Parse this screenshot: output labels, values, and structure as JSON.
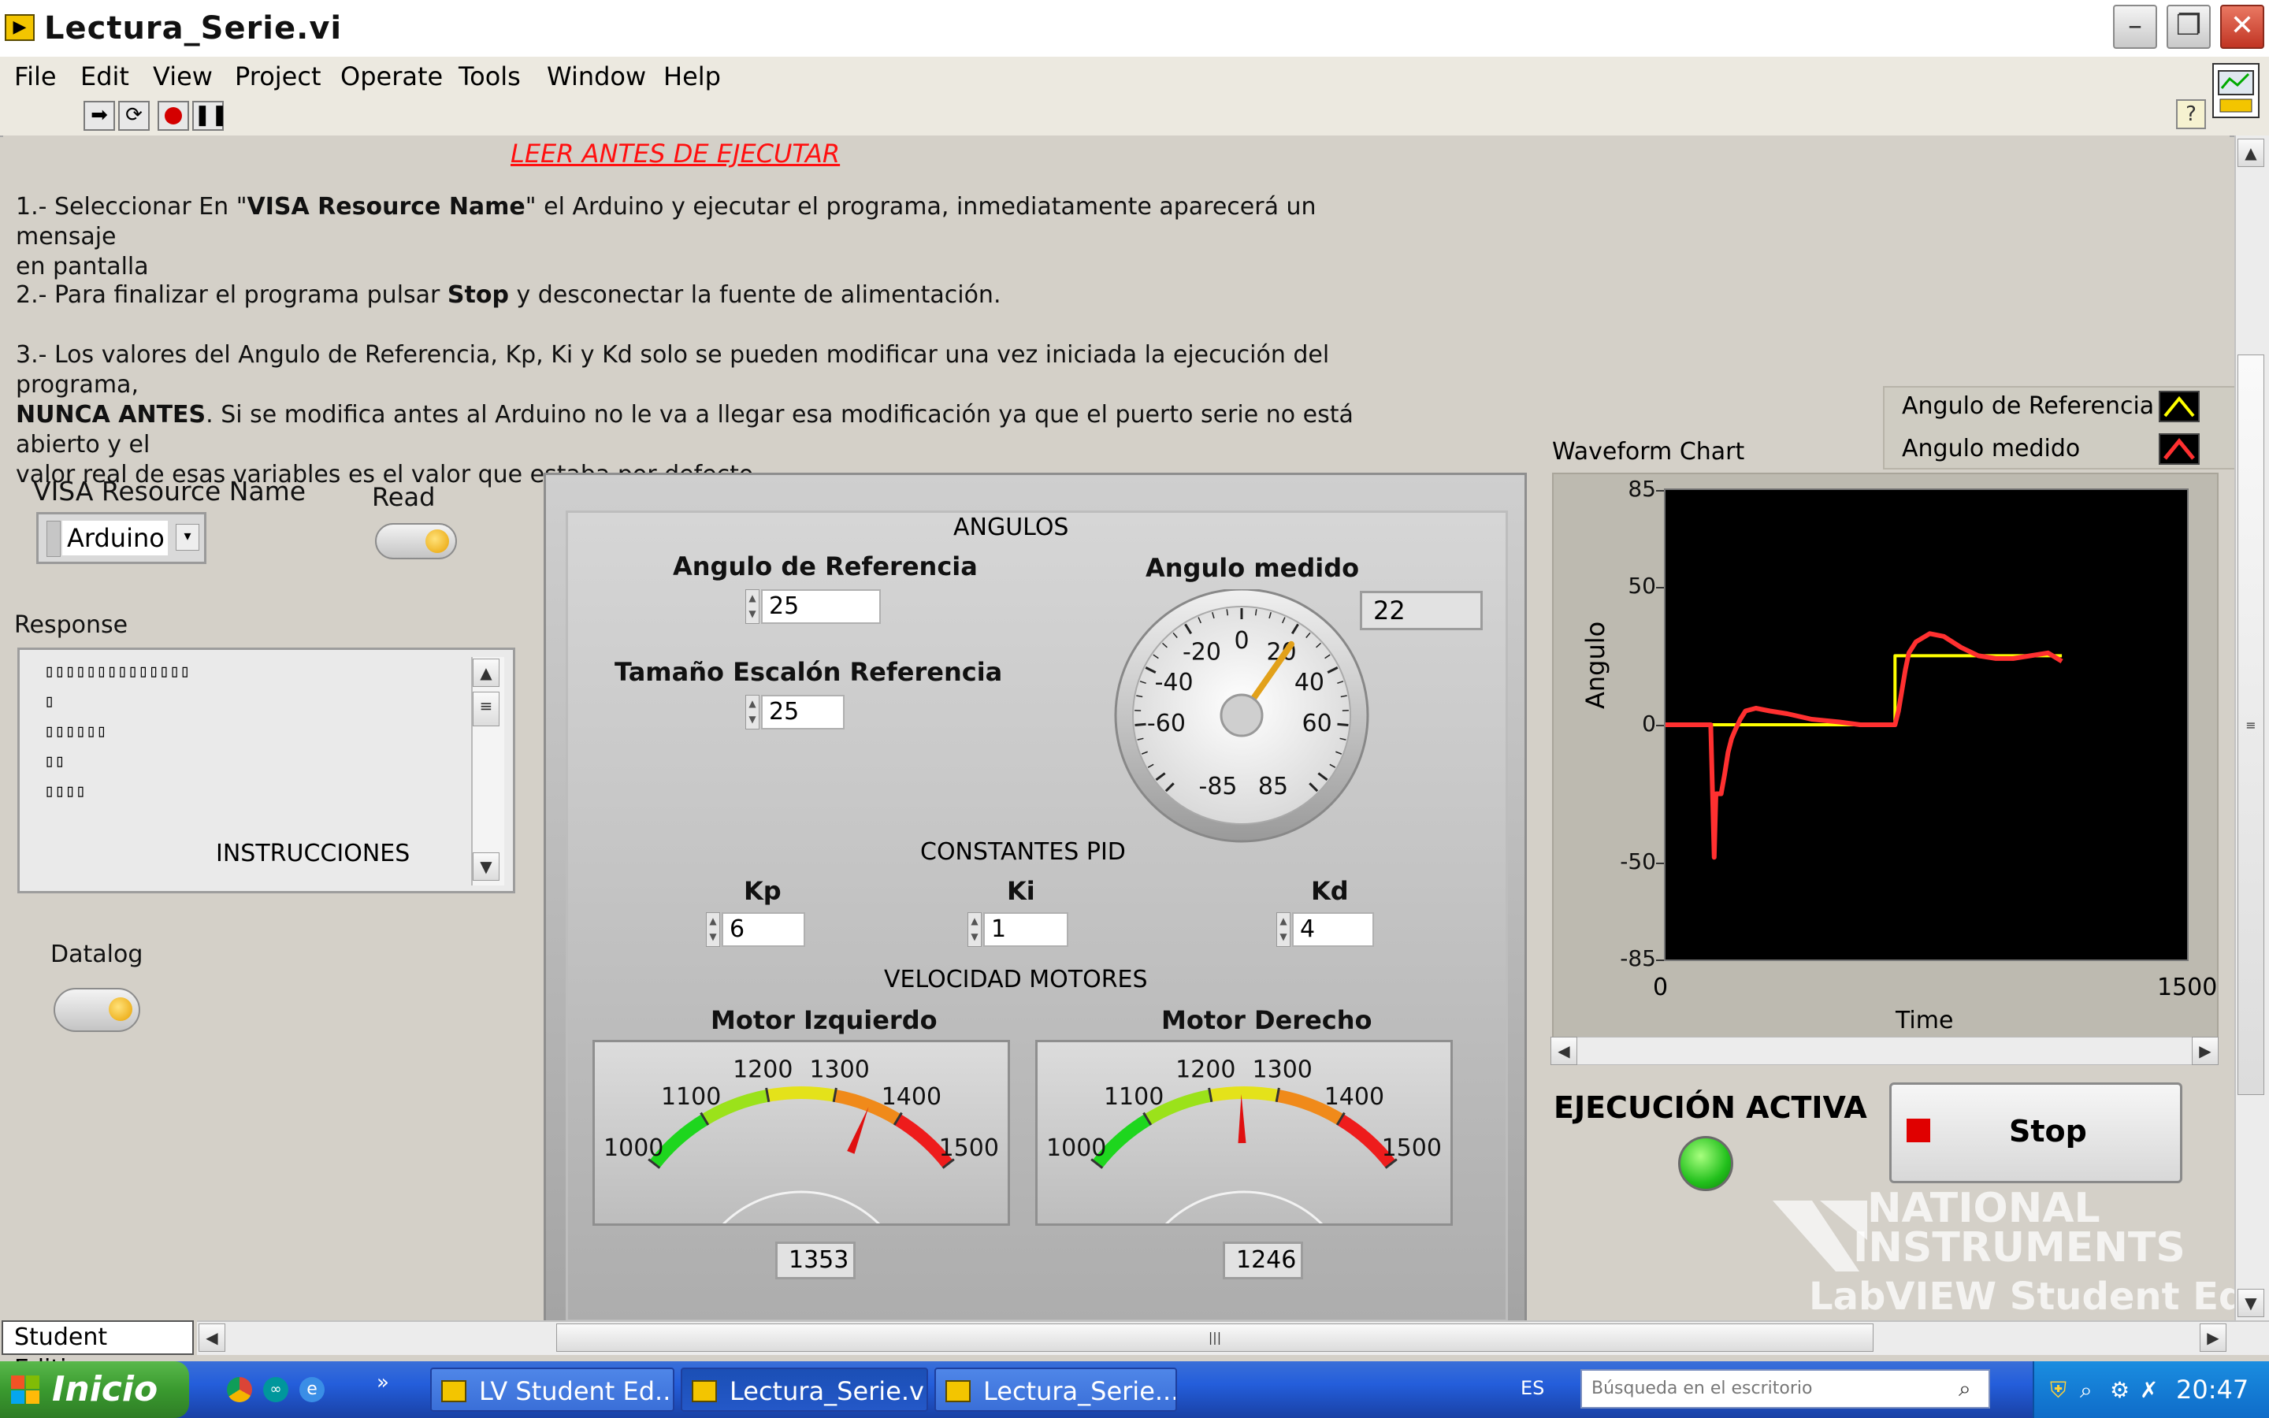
{
  "window": {
    "title": "Lectura_Serie.vi"
  },
  "menu": [
    "File",
    "Edit",
    "View",
    "Project",
    "Operate",
    "Tools",
    "Window",
    "Help"
  ],
  "toolbar": {
    "run_icon": "run-arrow-icon",
    "run_cont_icon": "run-continuously-icon",
    "abort_icon": "abort-icon",
    "pause_icon": "pause-icon",
    "help_label": "?"
  },
  "instructions": {
    "warning": "LEER ANTES DE EJECUTAR",
    "p1_a": "1.- Seleccionar En \"",
    "p1_b": "VISA Resource Name",
    "p1_c": "\" el Arduino y ejecutar el programa, inmediatamente aparecerá un mensaje",
    "p1_d": "en pantalla",
    "p2_a": "2.- Para finalizar el programa pulsar ",
    "p2_b": "Stop",
    "p2_c": " y desconectar la fuente de alimentación.",
    "p3_a": "3.- Los valores del Angulo de Referencia, Kp, Ki y Kd solo se pueden modificar una vez iniciada la ejecución del programa,",
    "p3_b": "NUNCA ANTES",
    "p3_c": ". Si se modifica antes al Arduino no le va a llegar esa modificación ya que el puerto serie no está abierto y el",
    "p3_d": "valor real de esas variables es el valor que estaba por defecto."
  },
  "visa": {
    "label": "VISA Resource Name",
    "value": "Arduino"
  },
  "read": {
    "label": "Read"
  },
  "response": {
    "label": "Response",
    "lines": [
      "▯▯▯▯▯▯▯▯▯▯▯▯▯▯",
      "▯",
      "▯▯▯▯▯▯",
      "▯▯",
      "▯▯▯▯"
    ],
    "footer": "INSTRUCCIONES"
  },
  "datalog": {
    "label": "Datalog"
  },
  "angulos": {
    "title": "ANGULOS",
    "ref_label": "Angulo de Referencia",
    "ref_value": "25",
    "step_label": "Tamaño Escalón Referencia",
    "step_value": "25",
    "measured_label": "Angulo medido",
    "measured_value": "22",
    "dial_ticks": [
      "0",
      "20",
      "40",
      "60",
      "85",
      "-85",
      "-60",
      "-40",
      "-20"
    ],
    "dial_value": 22
  },
  "pid": {
    "title": "CONSTANTES PID",
    "kp_label": "Kp",
    "kp_value": "6",
    "ki_label": "Ki",
    "ki_value": "1",
    "kd_label": "Kd",
    "kd_value": "4"
  },
  "motores": {
    "title": "VELOCIDAD MOTORES",
    "left_label": "Motor Izquierdo",
    "left_value": "1353",
    "left_level": 1353,
    "right_label": "Motor Derecho",
    "right_value": "1246",
    "right_level": 1246,
    "ticks": [
      "1000",
      "1100",
      "1200",
      "1300",
      "1400",
      "1500"
    ]
  },
  "chart": {
    "title": "Waveform Chart",
    "ylabel": "Angulo",
    "xlabel": "Time",
    "yticks": [
      "85",
      "50",
      "0",
      "-50",
      "-85"
    ],
    "xticks": [
      "0",
      "1500"
    ],
    "legend": [
      {
        "name": "Angulo de Referencia",
        "color": "#ffff00"
      },
      {
        "name": "Angulo medido",
        "color": "#ff3030"
      }
    ]
  },
  "chart_data": {
    "type": "line",
    "xlabel": "Time",
    "ylabel": "Angulo",
    "xlim": [
      0,
      1500
    ],
    "ylim": [
      -85,
      85
    ],
    "grid": false,
    "legend_position": "top-right",
    "series": [
      {
        "name": "Angulo de Referencia",
        "color": "#ffff00",
        "x": [
          0,
          110,
          110,
          660,
          660,
          1140
        ],
        "y": [
          0,
          0,
          0,
          0,
          25,
          25
        ]
      },
      {
        "name": "Angulo medido",
        "color": "#ff3030",
        "x": [
          0,
          130,
          140,
          145,
          160,
          170,
          180,
          190,
          200,
          215,
          230,
          260,
          300,
          350,
          420,
          500,
          560,
          620,
          660,
          670,
          690,
          700,
          720,
          760,
          800,
          850,
          900,
          950,
          1000,
          1050,
          1100,
          1140
        ],
        "y": [
          0,
          0,
          -48,
          -25,
          -25,
          -18,
          -10,
          -5,
          -2,
          2,
          5,
          6,
          5,
          4,
          2,
          1,
          0,
          0,
          0,
          5,
          20,
          26,
          30,
          33,
          32,
          28,
          25,
          24,
          24,
          25,
          26,
          23
        ]
      }
    ]
  },
  "ejecucion": {
    "label": "EJECUCIÓN ACTIVA"
  },
  "stop": {
    "label": "Stop"
  },
  "ni": {
    "line1": "NATIONAL",
    "line2": "INSTRUMENTS",
    "line3": "LabVIEW Student Edition"
  },
  "status": {
    "student": "Student Edition"
  },
  "taskbar": {
    "start": "Inicio",
    "tasks": [
      "LV Student Ed...",
      "Lectura_Serie.vi",
      "Lectura_Serie...."
    ],
    "lang": "ES",
    "search_placeholder": "Búsqueda en el escritorio",
    "clock": "20:47"
  }
}
